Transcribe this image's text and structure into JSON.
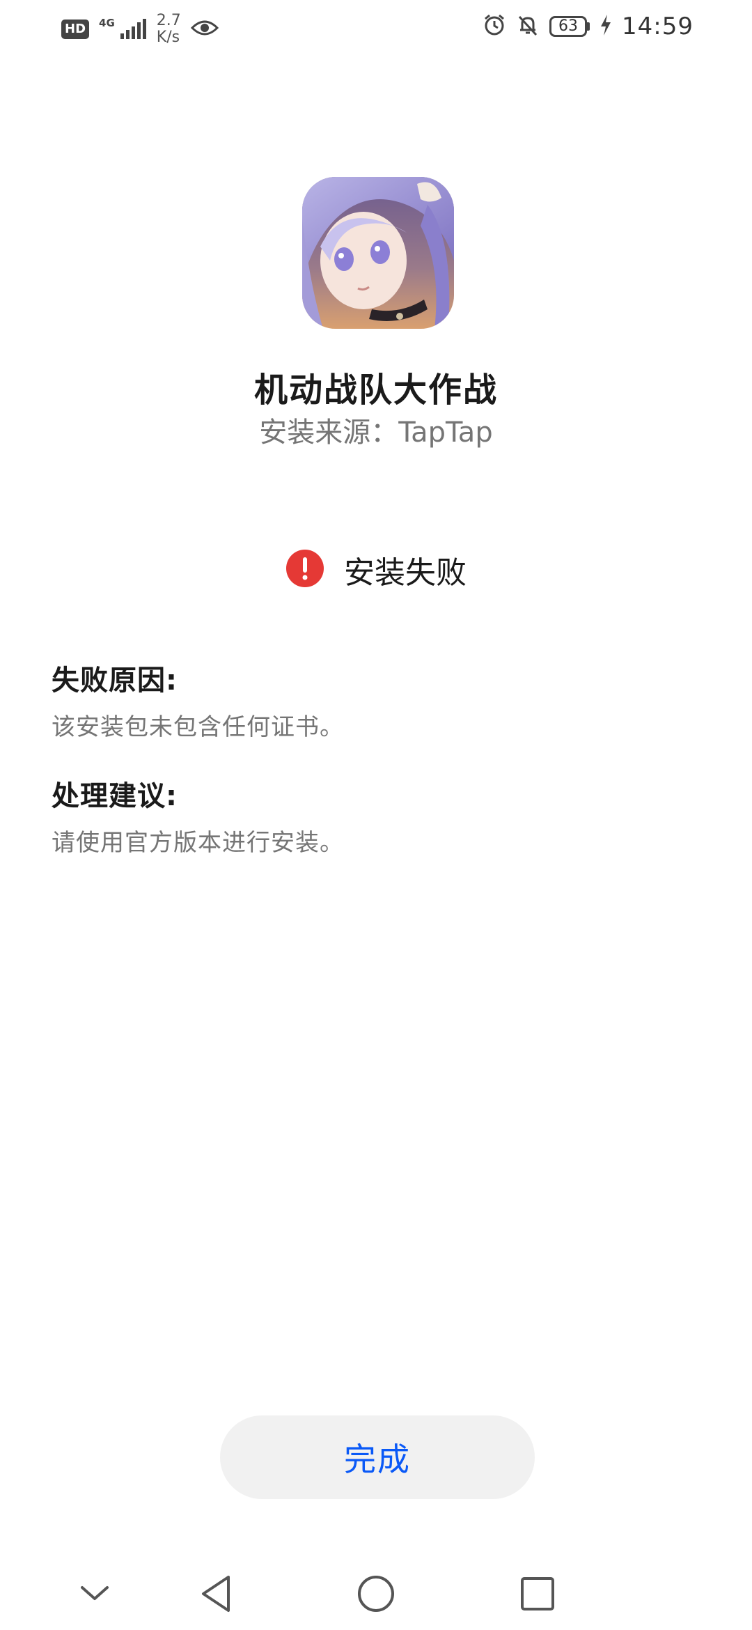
{
  "status_bar": {
    "hd_badge": "HD",
    "network_type": "4G",
    "net_speed_value": "2.7",
    "net_speed_unit": "K/s",
    "battery_level": "63",
    "time": "14:59"
  },
  "app": {
    "name": "机动战队大作战",
    "install_source": "安装来源：TapTap"
  },
  "result": {
    "status_text": "安装失败",
    "error_color": "#e53935"
  },
  "failure": {
    "title": "失败原因:",
    "body": "该安装包未包含任何证书。"
  },
  "suggestion": {
    "title": "处理建议:",
    "body": "请使用官方版本进行安装。"
  },
  "actions": {
    "done_label": "完成",
    "accent_color": "#0a59f7"
  },
  "nav_bar": {
    "icons": [
      "chevron-down-icon",
      "back-triangle-icon",
      "home-circle-icon",
      "recents-square-icon"
    ]
  }
}
